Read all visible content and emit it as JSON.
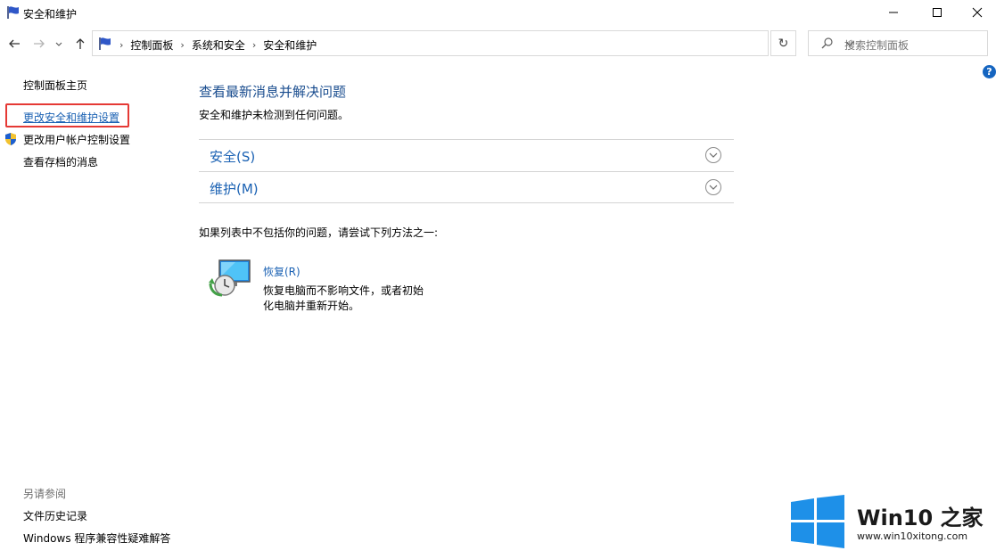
{
  "window": {
    "title": "安全和维护"
  },
  "address": {
    "crumbs": [
      "控制面板",
      "系统和安全",
      "安全和维护"
    ]
  },
  "search": {
    "placeholder": "搜索控制面板"
  },
  "help": {
    "label": "?"
  },
  "sidebar": {
    "home": "控制面板主页",
    "items": [
      "更改安全和维护设置",
      "更改用户帐户控制设置",
      "查看存档的消息"
    ],
    "see_also_title": "另请参阅",
    "see_also": [
      "文件历史记录",
      "Windows 程序兼容性疑难解答"
    ]
  },
  "main": {
    "heading": "查看最新消息并解决问题",
    "subtext": "安全和维护未检测到任何问题。",
    "sections": [
      "安全(S)",
      "维护(M)"
    ],
    "try_text": "如果列表中不包括你的问题，请尝试下列方法之一:",
    "recovery": {
      "link": "恢复(R)",
      "description": "恢复电脑而不影响文件，或者初始化电脑并重新开始。"
    }
  },
  "watermark": {
    "brand": "Win10 之家",
    "url": "www.win10xitong.com"
  },
  "colors": {
    "accent_link": "#1a61b3",
    "heading": "#1a4d8f",
    "highlight_box": "#e53935"
  }
}
